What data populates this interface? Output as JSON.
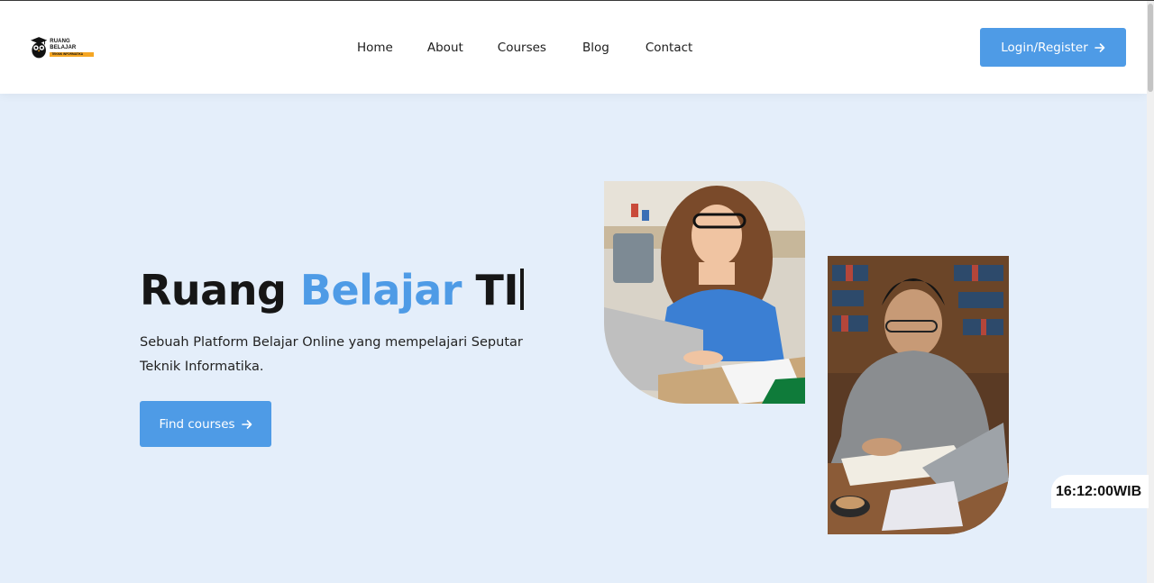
{
  "brand": {
    "title": "RUANG BELAJAR",
    "tagline": "TEKNIK INFORMATIKA"
  },
  "nav": {
    "items": [
      "Home",
      "About",
      "Courses",
      "Blog",
      "Contact"
    ]
  },
  "header": {
    "login_label": "Login/Register"
  },
  "hero": {
    "title_part1": "Ruang ",
    "title_accent": "Belajar",
    "title_part2": " TI",
    "description": "Sebuah Platform Belajar Online yang mempelajari Seputar Teknik Informatika.",
    "cta_label": "Find courses"
  },
  "clock": {
    "time": "16:12:00WIB"
  },
  "colors": {
    "accent": "#4e9be6",
    "hero_background": "#e4eefa",
    "header_background": "#ffffff",
    "text": "#161616"
  },
  "icons": {
    "arrow": "arrow-right-icon",
    "logo": "owl-graduation-icon"
  }
}
